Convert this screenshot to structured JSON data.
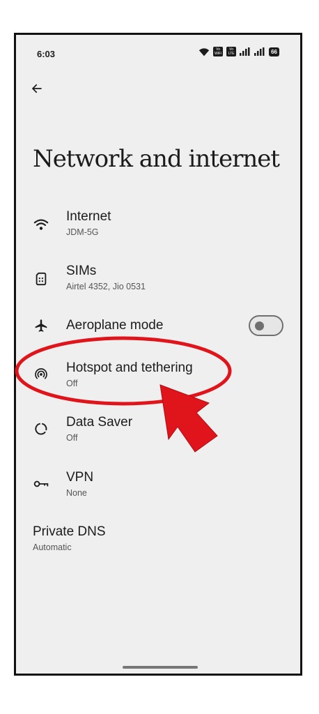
{
  "status_bar": {
    "time": "6:03",
    "badge_vowifi": [
      "Vo",
      "WiFi"
    ],
    "badge_volte": [
      "Vo",
      "LTE"
    ],
    "battery": "66"
  },
  "page_title": "Network and internet",
  "items": [
    {
      "title": "Internet",
      "subtitle": "JDM-5G",
      "icon": "wifi-icon"
    },
    {
      "title": "SIMs",
      "subtitle": "Airtel 4352, Jio 0531",
      "icon": "sim-card-icon"
    },
    {
      "title": "Aeroplane mode",
      "subtitle": "",
      "icon": "airplane-icon",
      "toggle_on": false
    },
    {
      "title": "Hotspot and tethering",
      "subtitle": "Off",
      "icon": "hotspot-icon"
    },
    {
      "title": "Data Saver",
      "subtitle": "Off",
      "icon": "data-saver-icon"
    },
    {
      "title": "VPN",
      "subtitle": "None",
      "icon": "vpn-key-icon"
    },
    {
      "title": "Private DNS",
      "subtitle": "Automatic"
    }
  ],
  "colors": {
    "background": "#efefef",
    "annotation_red": "#e0141b",
    "text_primary": "#1b1b1b",
    "text_secondary": "#555555"
  }
}
